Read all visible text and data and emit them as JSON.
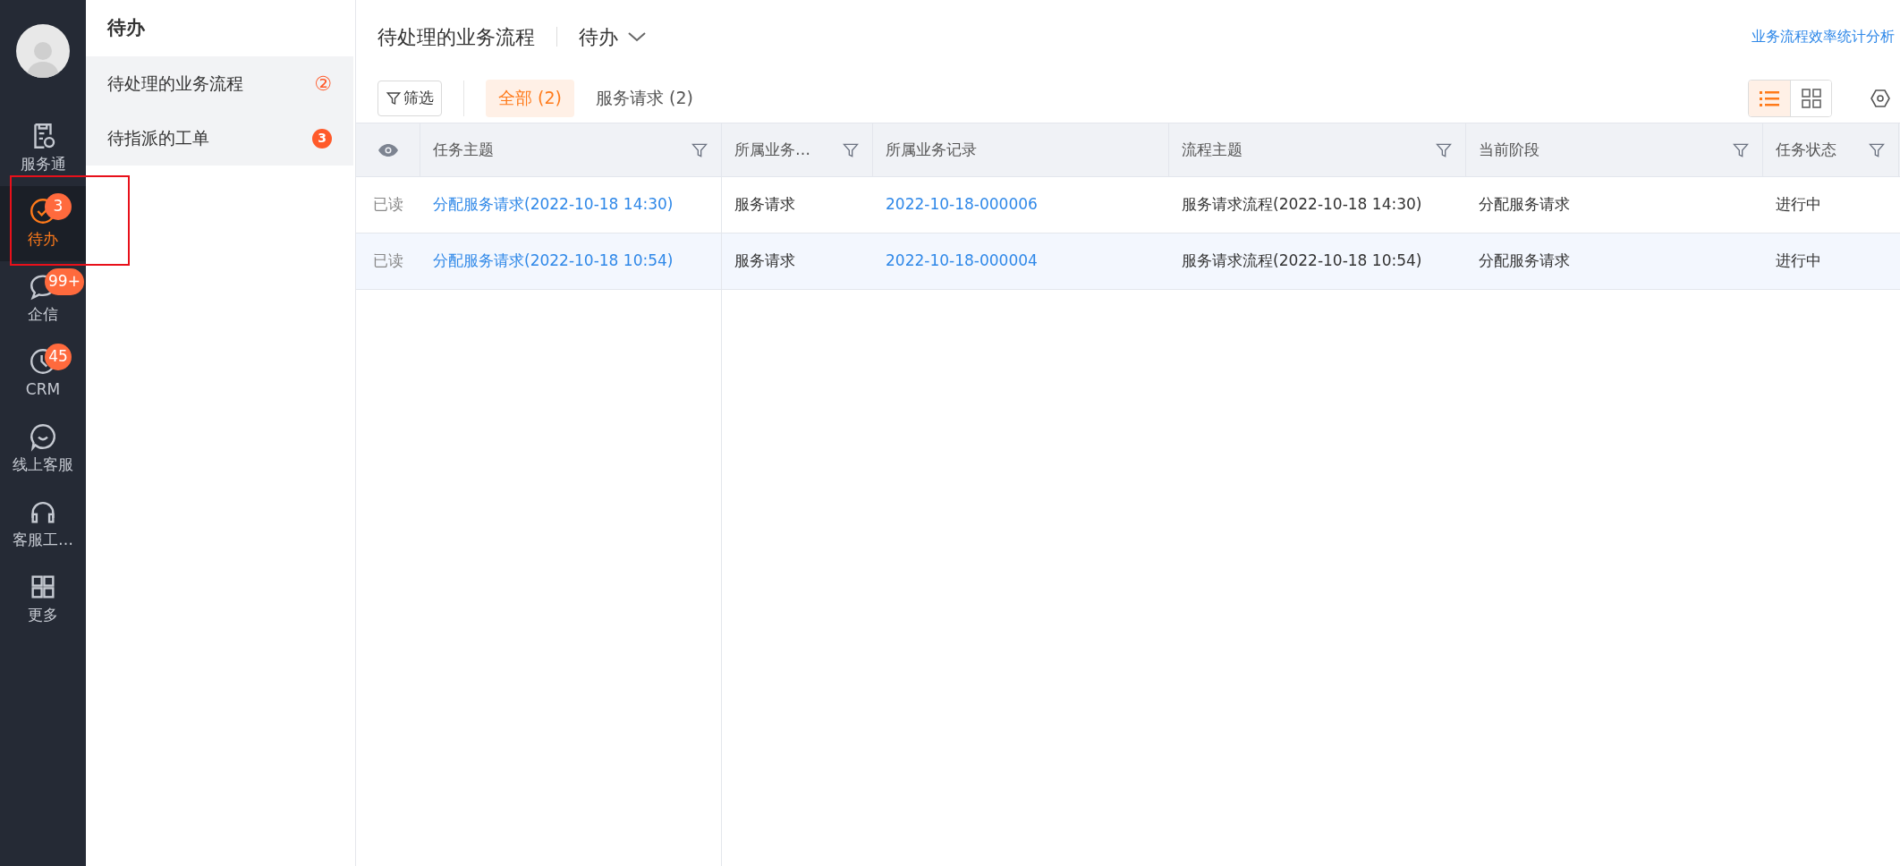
{
  "nav": [
    {
      "label": "服务通",
      "selected": false
    },
    {
      "label": "待办",
      "selected": true,
      "badge": "3"
    },
    {
      "label": "企信",
      "selected": false,
      "badge": "99+"
    },
    {
      "label": "CRM",
      "selected": false,
      "badge": "45"
    },
    {
      "label": "线上客服",
      "selected": false
    },
    {
      "label": "客服工…",
      "selected": false
    },
    {
      "label": "更多",
      "selected": false
    }
  ],
  "submenu": {
    "title": "待办",
    "items": [
      {
        "label": "待处理的业务流程",
        "badge": "②",
        "kind": "outline"
      },
      {
        "label": "待指派的工单",
        "badge": "3",
        "kind": "filled"
      }
    ]
  },
  "header": {
    "title": "待处理的业务流程",
    "dropdown": "待办",
    "link": "业务流程效率统计分析"
  },
  "filter_button": "筛选",
  "tabs": [
    {
      "label": "全部 (2)",
      "selected": true
    },
    {
      "label": "服务请求 (2)",
      "selected": false
    }
  ],
  "view_toggle": [
    {
      "selected": true
    },
    {
      "selected": false
    }
  ],
  "table": {
    "columns": [
      {
        "label": "任务主题",
        "filterable": true
      },
      {
        "label": "所属业务…",
        "filterable": true
      },
      {
        "label": "所属业务记录",
        "filterable": false
      },
      {
        "label": "流程主题",
        "filterable": true
      },
      {
        "label": "当前阶段",
        "filterable": true
      },
      {
        "label": "任务状态",
        "filterable": true
      }
    ],
    "rows": [
      {
        "read": "已读",
        "selected": false,
        "cells": [
          {
            "text": "分配服务请求(2022-10-18 14:30)",
            "kind": "link"
          },
          {
            "text": "服务请求",
            "kind": "text"
          },
          {
            "text": "2022-10-18-000006",
            "kind": "link"
          },
          {
            "text": "服务请求流程(2022-10-18 14:30)",
            "kind": "text"
          },
          {
            "text": "分配服务请求",
            "kind": "text"
          },
          {
            "text": "进行中",
            "kind": "text"
          }
        ]
      },
      {
        "read": "已读",
        "selected": true,
        "cells": [
          {
            "text": "分配服务请求(2022-10-18 10:54)",
            "kind": "link"
          },
          {
            "text": "服务请求",
            "kind": "text"
          },
          {
            "text": "2022-10-18-000004",
            "kind": "link"
          },
          {
            "text": "服务请求流程(2022-10-18 10:54)",
            "kind": "text"
          },
          {
            "text": "分配服务请求",
            "kind": "text"
          },
          {
            "text": "进行中",
            "kind": "text"
          }
        ]
      }
    ]
  }
}
